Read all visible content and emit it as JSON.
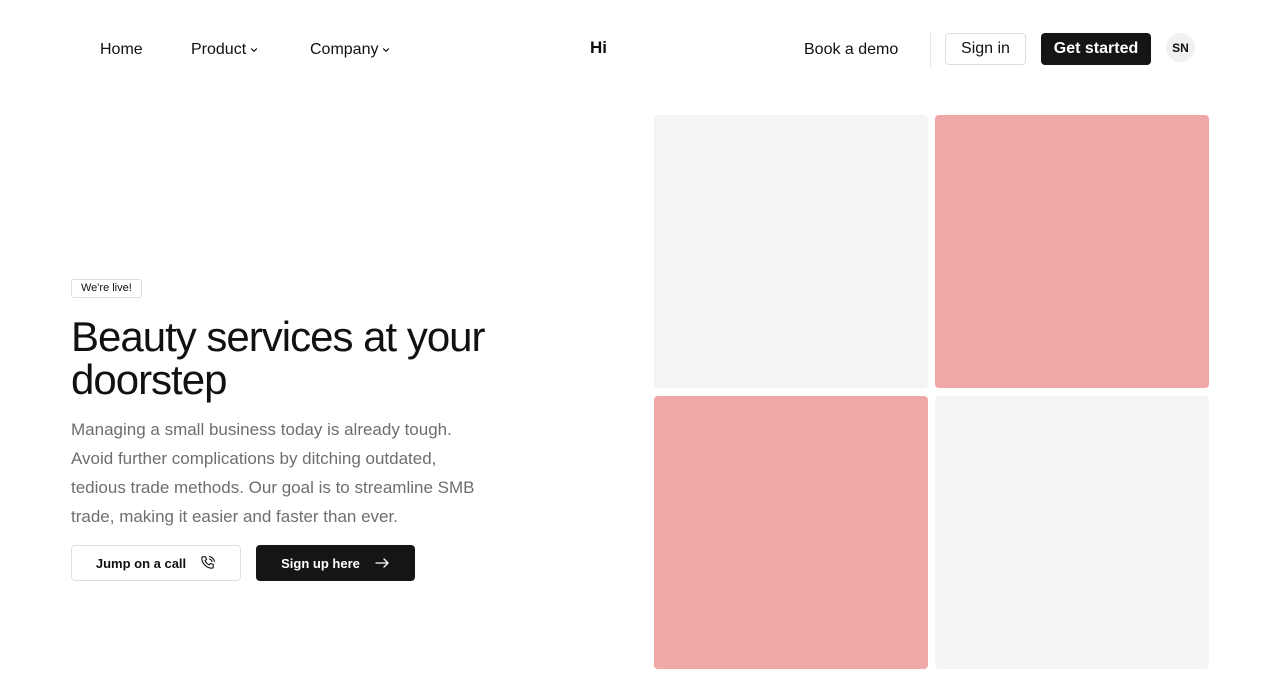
{
  "header": {
    "nav": [
      {
        "label": "Home",
        "has_dropdown": false
      },
      {
        "label": "Product",
        "has_dropdown": true
      },
      {
        "label": "Company",
        "has_dropdown": true
      }
    ],
    "brand": "Hi",
    "book_demo_label": "Book a demo",
    "sign_in_label": "Sign in",
    "get_started_label": "Get started",
    "avatar_initials": "SN"
  },
  "hero": {
    "badge": "We're live!",
    "headline": "Beauty services at your doorstep",
    "subtext": "Managing a small business today is already tough. Avoid further complications by ditching outdated, tedious trade methods. Our goal is to streamline SMB trade, making it easier and faster than ever.",
    "cta_call_label": "Jump on a call",
    "cta_call_icon": "phone-icon",
    "cta_signup_label": "Sign up here",
    "cta_signup_icon": "arrow-right-icon"
  },
  "gallery": {
    "tiles": [
      {
        "color": "#f4f4f4"
      },
      {
        "color": "#f0a8a7"
      },
      {
        "color": "#f0a8a7"
      },
      {
        "color": "#f4f4f4"
      }
    ]
  },
  "colors": {
    "primary_dark": "#151515",
    "accent_pink": "#f0a8a7",
    "tile_gray": "#f4f4f4",
    "muted_text": "#6e6e6e"
  }
}
